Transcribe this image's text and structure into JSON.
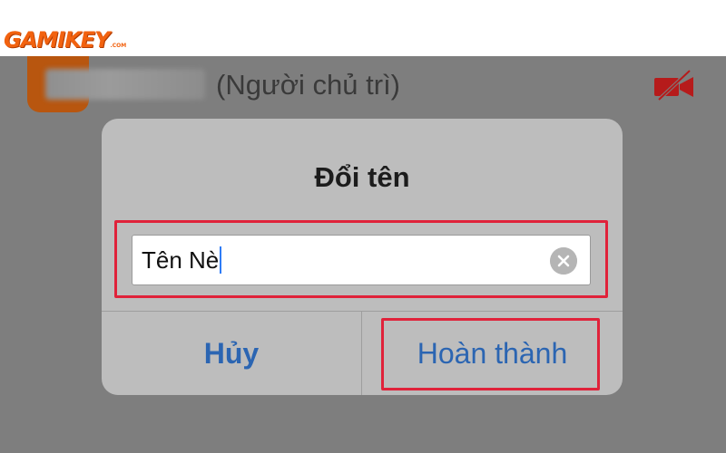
{
  "watermark": {
    "logo_text": "GAMIKEY",
    "logo_suffix": ".COM"
  },
  "background": {
    "participant_host_label": "(Người chủ trì)",
    "camera_icon": "camera-off-icon"
  },
  "dialog": {
    "title": "Đổi tên",
    "name_input_value": "Tên Nè",
    "clear_icon": "clear-circle-icon",
    "cancel_label": "Hủy",
    "done_label": "Hoàn thành"
  },
  "colors": {
    "accent_blue": "#2b65b2",
    "highlight_red": "#e0223a",
    "logo_orange": "#f2620f"
  }
}
